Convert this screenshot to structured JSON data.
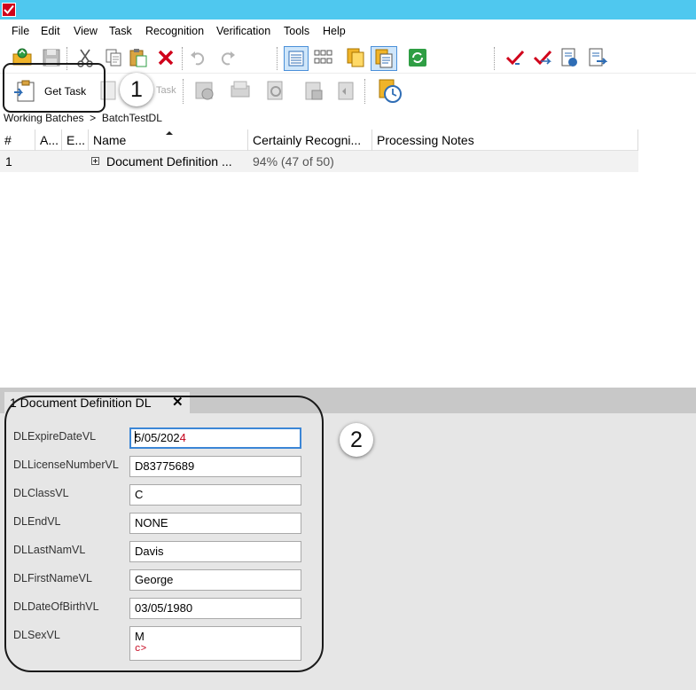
{
  "menu": {
    "items": [
      "File",
      "Edit",
      "View",
      "Task",
      "Recognition",
      "Verification",
      "Tools",
      "Help"
    ]
  },
  "toolbar": {
    "get_task_label": "Get Task",
    "ghost_label": "Task"
  },
  "callouts": {
    "one": "1",
    "two": "2"
  },
  "breadcrumb": {
    "root": "Working Batches",
    "separator": ">",
    "current": "BatchTestDL"
  },
  "grid": {
    "columns": [
      "#",
      "A...",
      "E...",
      "Name",
      "Certainly Recogni...",
      "Processing Notes"
    ],
    "rows": [
      {
        "index": "1",
        "name": "Document Definition ...",
        "certainty": "94% (47 of 50)",
        "notes": ""
      }
    ]
  },
  "detail": {
    "tab_label": "1 Document Definition DL",
    "tab_close": "✕",
    "fields": [
      {
        "label": "DLExpireDateVL",
        "value_prefix": "5/05/202",
        "value_error": "4"
      },
      {
        "label": "DLLicenseNumberVL",
        "value": "D83775689"
      },
      {
        "label": "DLClassVL",
        "value": "C"
      },
      {
        "label": "DLEndVL",
        "value": "NONE"
      },
      {
        "label": "DLLastNamVL",
        "value": "Davis"
      },
      {
        "label": "DLFirstNameVL",
        "value": "George"
      },
      {
        "label": "DLDateOfBirthVL",
        "value": "03/05/1980"
      },
      {
        "label": "DLSexVL",
        "value": "M",
        "value_line2": "c>"
      }
    ]
  },
  "colors": {
    "titlebar": "#4fc8ef",
    "focus_border": "#3b86d6",
    "error_text": "#c4001a",
    "detail_bg": "#e6e6e6"
  }
}
